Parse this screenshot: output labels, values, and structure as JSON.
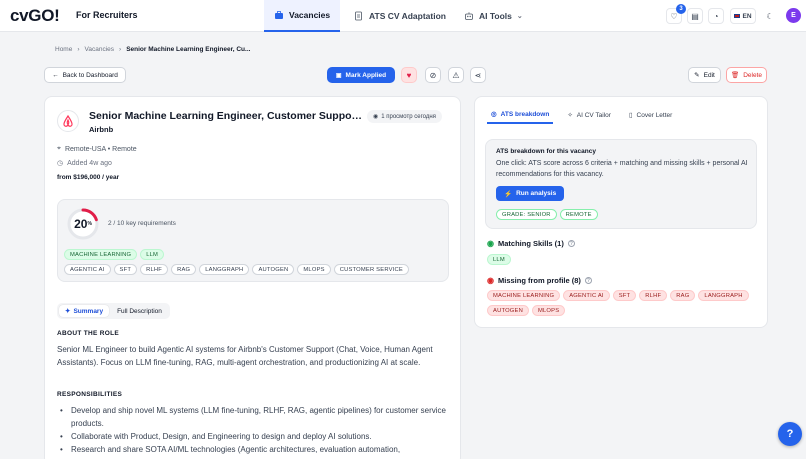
{
  "app": {
    "logo_text": "cvGO!",
    "tagline": "For Recruiters",
    "nav": [
      {
        "label": "Vacancies",
        "icon": "briefcase-icon"
      },
      {
        "label": "ATS CV Adaptation",
        "icon": "document-sync-icon"
      },
      {
        "label": "AI Tools",
        "icon": "robot-icon"
      }
    ],
    "favorites_count": "3",
    "language": "EN",
    "user_initial": "E"
  },
  "breadcrumb": {
    "home": "Home",
    "section": "Vacancies",
    "current": "Senior Machine Learning Engineer, Cu..."
  },
  "actions": {
    "back": "Back to Dashboard",
    "mark_applied": "Mark Applied",
    "edit": "Edit",
    "delete": "Delete"
  },
  "job": {
    "title": "Senior Machine Learning Engineer, Customer Support Engi...",
    "company": "Airbnb",
    "views": "1 просмотр сегодня",
    "location": "Remote-USA • Remote",
    "added": "Added 4w ago",
    "salary": "from $196,000 / year",
    "score": "20",
    "score_unit": "%",
    "score_fraction": 0.2,
    "key_requirements": "2 / 10 key requirements",
    "matched_chips": [
      "MACHINE LEARNING",
      "LLM"
    ],
    "other_chips": [
      "AGENTIC AI",
      "SFT",
      "RLHF",
      "RAG",
      "LANGGRAPH",
      "AUTOGEN",
      "MLOPS",
      "CUSTOMER SERVICE"
    ],
    "tabs": {
      "summary": "Summary",
      "full": "Full Description"
    },
    "about_heading": "ABOUT THE ROLE",
    "about_text": "Senior ML Engineer to build Agentic AI systems for Airbnb's Customer Support (Chat, Voice, Human Agent Assistants). Focus on LLM fine-tuning, RAG, multi-agent orchestration, and productionizing AI at scale.",
    "resp_heading": "RESPONSIBILITIES",
    "responsibilities": [
      "Develop and ship novel ML systems (LLM fine-tuning, RLHF, RAG, agentic pipelines) for customer service products.",
      "Collaborate with Product, Design, and Engineering to design and deploy AI solutions.",
      "Research and share SOTA AI/ML technologies (Agentic architectures, evaluation automation,"
    ]
  },
  "side": {
    "tabs": [
      "ATS breakdown",
      "AI CV Tailor",
      "Cover Letter"
    ],
    "ats_title": "ATS breakdown for this vacancy",
    "ats_desc": "One click: ATS score across 6 criteria + matching and missing skills + personal AI recommendations for this vacancy.",
    "run_label": "Run analysis",
    "grade_chips": [
      "GRADE: SENIOR",
      "REMOTE"
    ],
    "matching_heading": "Matching Skills (1)",
    "matching": [
      "LLM"
    ],
    "missing_heading": "Missing from profile (8)",
    "missing": [
      "MACHINE LEARNING",
      "AGENTIC AI",
      "SFT",
      "RLHF",
      "RAG",
      "LANGGRAPH",
      "AUTOGEN",
      "MLOPS"
    ]
  },
  "colors": {
    "accent": "#2563eb",
    "success": "#16a34a",
    "danger": "#dc2626",
    "score_ring": "#e11d48"
  }
}
